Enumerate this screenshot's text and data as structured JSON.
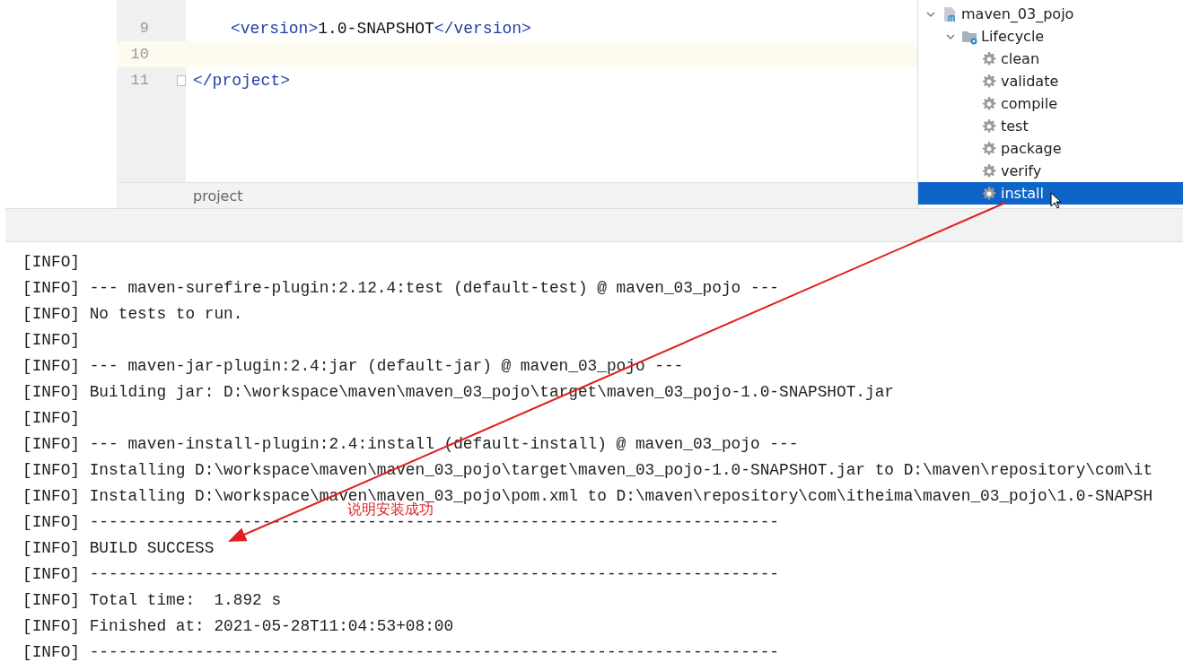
{
  "editor": {
    "lines": [
      {
        "number": "9",
        "current": false,
        "fold": false,
        "tokens": [
          {
            "kind": "tag",
            "text": "<version>"
          },
          {
            "kind": "text",
            "text": "1.0-SNAPSHOT"
          },
          {
            "kind": "tag",
            "text": "</version>"
          }
        ],
        "indent": true
      },
      {
        "number": "10",
        "current": true,
        "fold": false,
        "indent": false
      },
      {
        "number": "11",
        "current": false,
        "fold": true,
        "tokens": [
          {
            "kind": "tag",
            "text": "</project>"
          }
        ],
        "indent": false
      }
    ],
    "breadcrumb": "project"
  },
  "maven_tree": {
    "items": [
      {
        "label": "maven_03_pojo",
        "kind": "project",
        "expanded": true,
        "selected": false,
        "children": [
          {
            "label": "Lifecycle",
            "kind": "folder",
            "expanded": true,
            "selected": false,
            "children": [
              {
                "label": "clean",
                "kind": "goal",
                "selected": false
              },
              {
                "label": "validate",
                "kind": "goal",
                "selected": false
              },
              {
                "label": "compile",
                "kind": "goal",
                "selected": false
              },
              {
                "label": "test",
                "kind": "goal",
                "selected": false
              },
              {
                "label": "package",
                "kind": "goal",
                "selected": false
              },
              {
                "label": "verify",
                "kind": "goal",
                "selected": false
              },
              {
                "label": "install",
                "kind": "goal",
                "selected": true
              }
            ]
          }
        ]
      }
    ]
  },
  "console": {
    "lines": [
      "[INFO]",
      "[INFO] --- maven-surefire-plugin:2.12.4:test (default-test) @ maven_03_pojo ---",
      "[INFO] No tests to run.",
      "[INFO]",
      "[INFO] --- maven-jar-plugin:2.4:jar (default-jar) @ maven_03_pojo ---",
      "[INFO] Building jar: D:\\workspace\\maven\\maven_03_pojo\\target\\maven_03_pojo-1.0-SNAPSHOT.jar",
      "[INFO]",
      "[INFO] --- maven-install-plugin:2.4:install (default-install) @ maven_03_pojo ---",
      "[INFO] Installing D:\\workspace\\maven\\maven_03_pojo\\target\\maven_03_pojo-1.0-SNAPSHOT.jar to D:\\maven\\repository\\com\\it",
      "[INFO] Installing D:\\workspace\\maven\\maven_03_pojo\\pom.xml to D:\\maven\\repository\\com\\itheima\\maven_03_pojo\\1.0-SNAPSH",
      "[INFO] ------------------------------------------------------------------------",
      "[INFO] BUILD SUCCESS",
      "[INFO] ------------------------------------------------------------------------",
      "[INFO] Total time:  1.892 s",
      "[INFO] Finished at: 2021-05-28T11:04:53+08:00",
      "[INFO] ------------------------------------------------------------------------"
    ]
  },
  "annotation": {
    "text": "说明安装成功"
  }
}
